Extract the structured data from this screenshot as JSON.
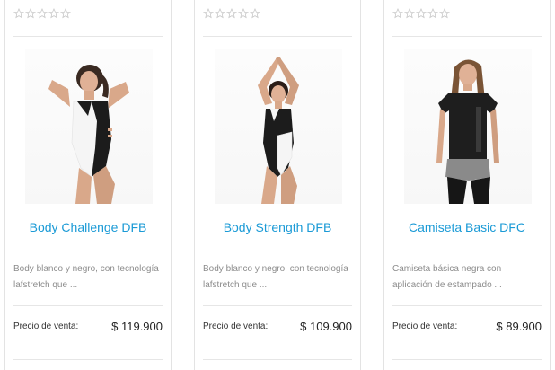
{
  "products": [
    {
      "title": "Body Challenge DFB",
      "description": "Body blanco y negro, con tecnología lafstretch que ...",
      "price_label": "Precio de venta:",
      "price": "$ 119.900",
      "rating": 0,
      "rating_max": 5,
      "image_icon": "bodysuit-white-black-photo"
    },
    {
      "title": "Body Strength DFB",
      "description": "Body blanco y negro, con tecnología lafstretch que ...",
      "price_label": "Precio de venta:",
      "price": "$ 109.900",
      "rating": 0,
      "rating_max": 5,
      "image_icon": "bodysuit-black-white-photo"
    },
    {
      "title": "Camiseta Basic DFC",
      "description": "Camiseta básica negra con aplicación de estampado ...",
      "price_label": "Precio de venta:",
      "price": "$ 89.900",
      "rating": 0,
      "rating_max": 5,
      "image_icon": "black-tshirt-photo"
    }
  ],
  "colors": {
    "title": "#1a9ad6",
    "description": "#8c8c8c",
    "star_outline": "#c8c8c8",
    "divider": "#e6e6e6"
  }
}
